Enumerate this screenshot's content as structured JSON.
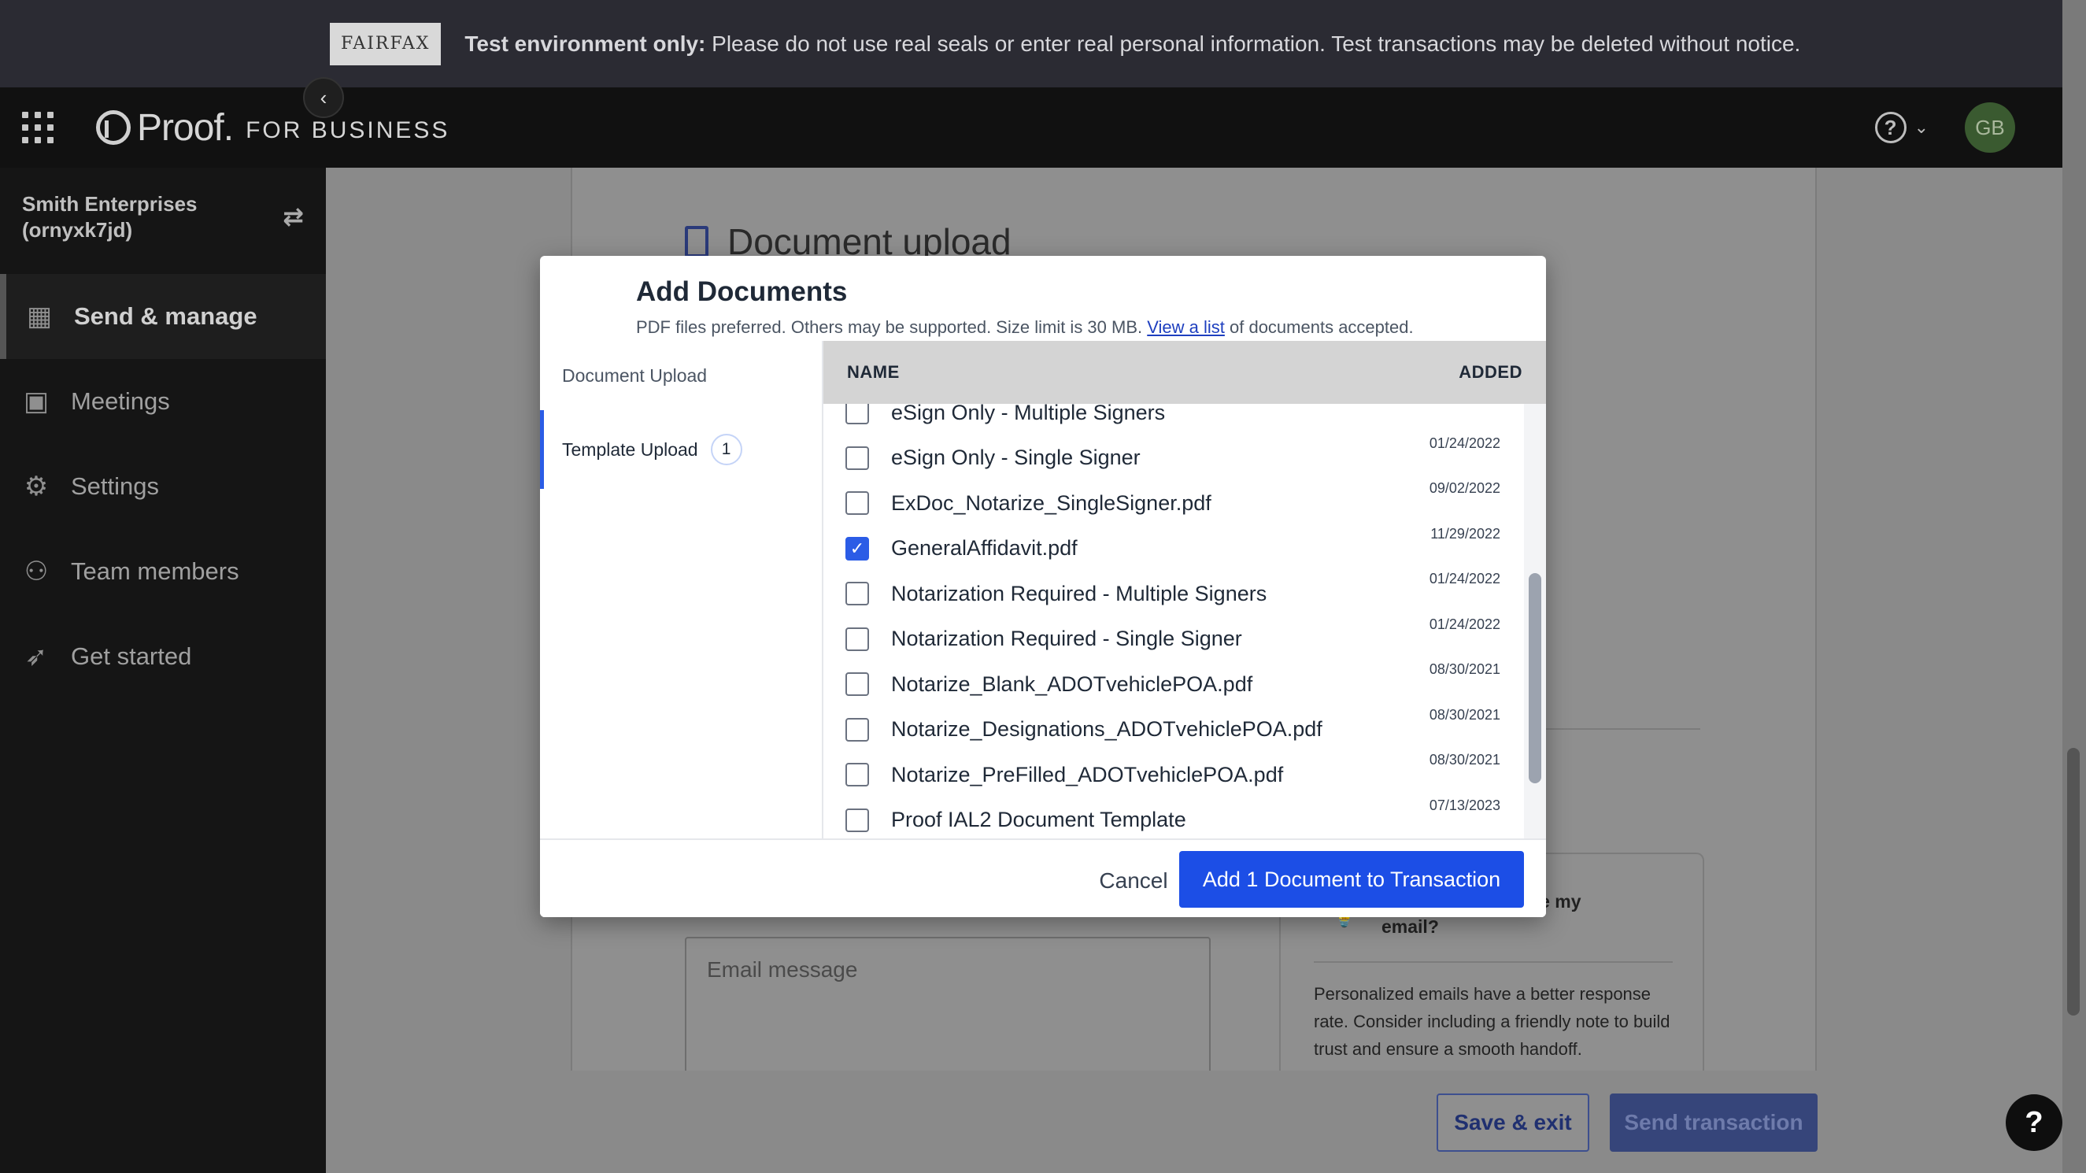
{
  "banner": {
    "logo_text": "FAIRFAX",
    "bold_text": "Test environment only:",
    "message": " Please do not use real seals or enter real personal information. Test transactions may be deleted without notice."
  },
  "header": {
    "brand": "Proof.",
    "brand_sub": "FOR BUSINESS",
    "avatar_initials": "GB",
    "icons": [
      "apps-grid-icon",
      "help-icon",
      "chevron-down-icon"
    ]
  },
  "sidebar": {
    "org_name": "Smith Enterprises",
    "org_id": "(ornyxk7jd)",
    "items": [
      {
        "label": "Send & manage",
        "icon": "dashboard-icon",
        "active": true
      },
      {
        "label": "Meetings",
        "icon": "calendar-icon",
        "active": false
      },
      {
        "label": "Settings",
        "icon": "gear-icon",
        "active": false
      },
      {
        "label": "Team members",
        "icon": "users-icon",
        "active": false
      },
      {
        "label": "Get started",
        "icon": "rocket-icon",
        "active": false
      }
    ]
  },
  "background": {
    "section_title": "Document upload",
    "email_placeholder": "Email message",
    "tip_title": "Why should I personalize my email?",
    "tip_title_visible": "nalize my",
    "tip_title_line2": "email?",
    "tip_body": "Personalized emails have a better response rate. Consider including a friendly note to build trust and ensure a smooth handoff.",
    "save_exit": "Save & exit",
    "send_transaction": "Send transaction"
  },
  "modal": {
    "title": "Add Documents",
    "subtitle_pre": "PDF files preferred. Others may be supported. Size limit is 30 MB. ",
    "subtitle_link": "View a list",
    "subtitle_post": " of documents accepted.",
    "tabs": [
      {
        "label": "Document Upload",
        "badge": ""
      },
      {
        "label": "Template Upload",
        "badge": "1"
      }
    ],
    "columns": {
      "name": "NAME",
      "added": "ADDED"
    },
    "rows": [
      {
        "name": "eSign Only - Multiple Signers",
        "added": "01/24/2022",
        "checked": false
      },
      {
        "name": "eSign Only - Single Signer",
        "added": "01/24/2022",
        "checked": false
      },
      {
        "name": "ExDoc_Notarize_SingleSigner.pdf",
        "added": "09/02/2022",
        "checked": false
      },
      {
        "name": "GeneralAffidavit.pdf",
        "added": "11/29/2022",
        "checked": true
      },
      {
        "name": "Notarization Required - Multiple Signers",
        "added": "01/24/2022",
        "checked": false
      },
      {
        "name": "Notarization Required - Single Signer",
        "added": "01/24/2022",
        "checked": false
      },
      {
        "name": "Notarize_Blank_ADOTvehiclePOA.pdf",
        "added": "08/30/2021",
        "checked": false
      },
      {
        "name": "Notarize_Designations_ADOTvehiclePOA.pdf",
        "added": "08/30/2021",
        "checked": false
      },
      {
        "name": "Notarize_PreFilled_ADOTvehiclePOA.pdf",
        "added": "08/30/2021",
        "checked": false
      },
      {
        "name": "Proof IAL2 Document Template",
        "added": "07/13/2023",
        "checked": false
      }
    ],
    "cancel_label": "Cancel",
    "add_label": "Add 1 Document to Transaction"
  }
}
